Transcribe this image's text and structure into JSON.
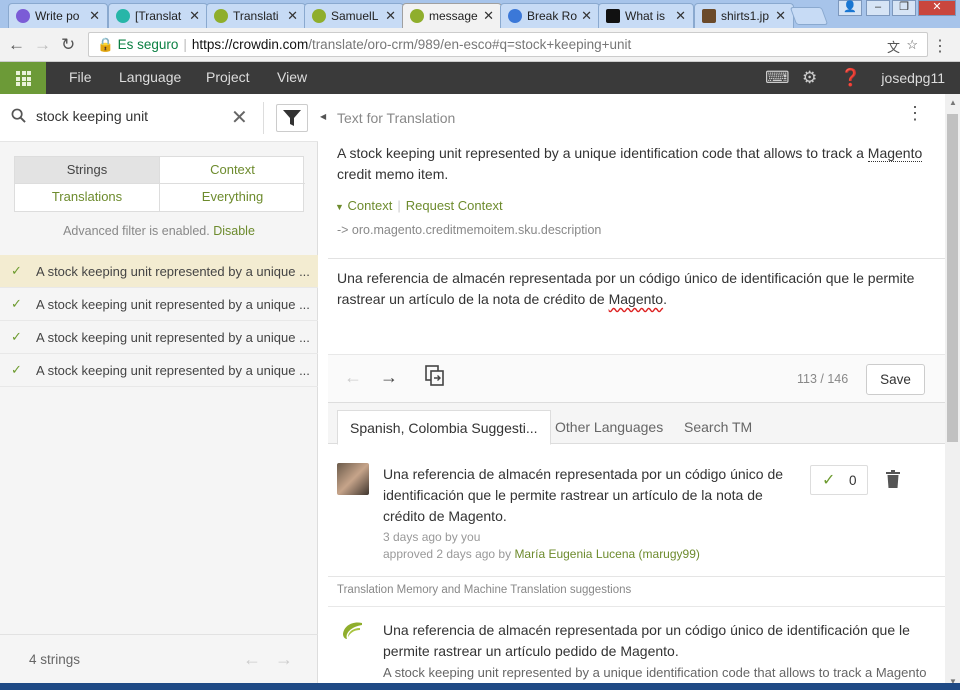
{
  "browser": {
    "tabs": [
      {
        "title": "Write po",
        "fav_color": "#7b5cd6"
      },
      {
        "title": "[Translat",
        "fav_color": "#27b6a8"
      },
      {
        "title": "Translati",
        "fav_color": "#8fae2c"
      },
      {
        "title": "SamuelL",
        "fav_color": "#8fae2c"
      },
      {
        "title": "message",
        "fav_color": "#8fae2c"
      },
      {
        "title": "Break Ro",
        "fav_color": "#3b78d8"
      },
      {
        "title": "What is",
        "fav_color": "#111111"
      },
      {
        "title": "shirts1.jp",
        "fav_color": "#6b4a2a"
      }
    ],
    "secure_label": "Es seguro",
    "url_host": "https://crowdin.com",
    "url_path": "/translate/oro-crm/989/en-esco#q=stock+keeping+unit"
  },
  "menubar": {
    "items": [
      "File",
      "Language",
      "Project",
      "View"
    ],
    "username": "josedpg11"
  },
  "search": {
    "value": "stock keeping unit"
  },
  "filters": {
    "strings": "Strings",
    "context": "Context",
    "translations": "Translations",
    "everything": "Everything"
  },
  "advanced_filter": {
    "text": "Advanced filter is enabled.",
    "link": "Disable"
  },
  "string_list": [
    "A stock keeping unit represented by a unique ...",
    "A stock keeping unit represented by a unique ...",
    "A stock keeping unit represented by a unique ...",
    "A stock keeping unit represented by a unique ..."
  ],
  "footer": {
    "count": "4 strings"
  },
  "source": {
    "header": "Text for Translation",
    "text_before": "A stock keeping unit represented by a unique identification code that allows to track a ",
    "text_underlined": "Magento",
    "text_after": " credit memo item.",
    "context_link": "Context",
    "request_context": "Request Context",
    "context_id": "-> oro.magento.creditmemoitem.sku.description"
  },
  "translation": {
    "text_before": "Una referencia de almacén representada por un código único de identificación que le permite rastrear un artículo de la nota de crédito de ",
    "text_spell": "Magento",
    "text_after": "."
  },
  "editor": {
    "counter": "113 / 146",
    "save": "Save"
  },
  "suggestion_tabs": [
    "Spanish, Colombia Suggesti...",
    "Other Languages",
    "Search TM"
  ],
  "suggestion": {
    "text": "Una referencia de almacén representada por un código único de identificación que le permite rastrear un artículo de la nota de crédito de Magento.",
    "time": "3 days ago by you",
    "approved_prefix": "approved 2 days ago by",
    "approved_by": "María Eugenia Lucena (marugy99)",
    "votes": "0"
  },
  "tm": {
    "header": "Translation Memory and Machine Translation suggestions",
    "text": "Una referencia de almacén representada por un código único de identificación que le permite rastrear un artículo pedido de Magento.",
    "source": "A stock keeping unit represented by a unique identification code that allows to track a Magento"
  }
}
